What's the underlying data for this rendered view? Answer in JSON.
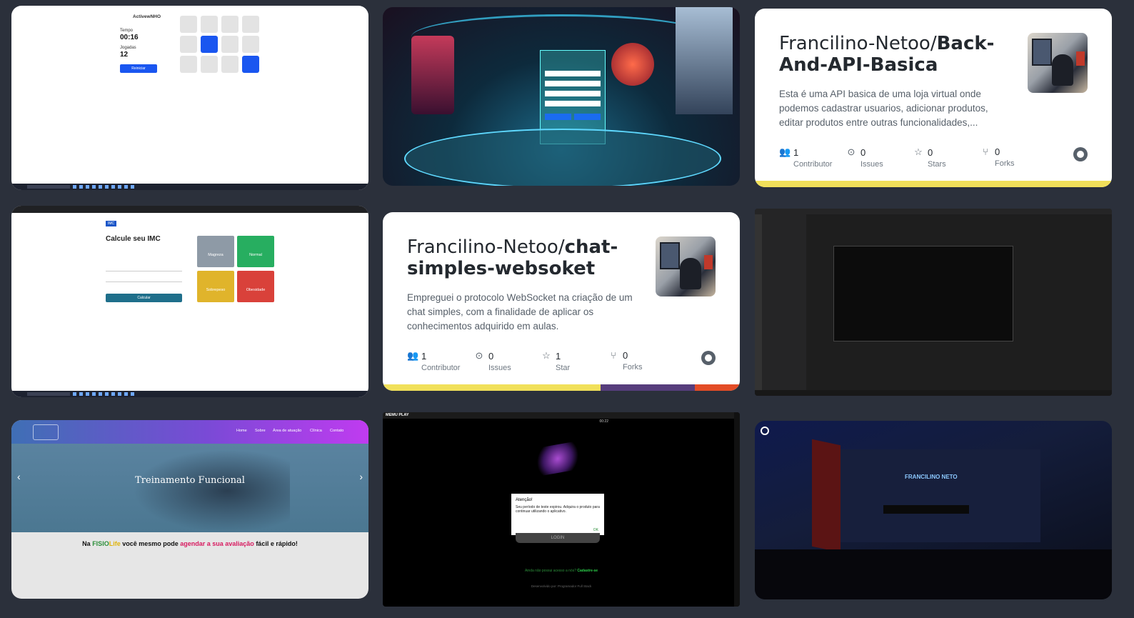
{
  "memory_game": {
    "title": "ActivewNHO",
    "time_label": "Tempo",
    "time_value": "00:16",
    "moves_label": "Jogadas",
    "moves_value": "12",
    "restart_label": "Reiniciar"
  },
  "repo1": {
    "owner": "Francilino-Netoo/",
    "name": "Back-And-API-Basica",
    "description": "Esta é uma API basica de uma loja virtual onde podemos cadastrar usuarios, adicionar produtos, editar produtos entre outras funcionalidades,...",
    "stats": [
      {
        "icon": "people-icon",
        "value": "1",
        "label": "Contributor"
      },
      {
        "icon": "issue-icon",
        "value": "0",
        "label": "Issues"
      },
      {
        "icon": "star-icon",
        "value": "0",
        "label": "Stars"
      },
      {
        "icon": "fork-icon",
        "value": "0",
        "label": "Forks"
      }
    ],
    "bar_colors": [
      "#f1e05a"
    ]
  },
  "imc": {
    "brand": "IMC",
    "title": "Calcule seu IMC",
    "button": "Calcular",
    "categories": [
      {
        "label": "Magreza",
        "color": "#8e9aa6"
      },
      {
        "label": "Normal",
        "color": "#27ae60"
      },
      {
        "label": "Sobrepeso",
        "color": "#e0b42b"
      },
      {
        "label": "Obesidade",
        "color": "#d9413a"
      }
    ]
  },
  "repo2": {
    "owner": "Francilino-Netoo/",
    "name": "chat-simples-websoket",
    "description": "Empreguei o protocolo WebSocket na criação de um chat simples, com a finalidade de aplicar os conhecimentos adquirido em aulas.",
    "stats": [
      {
        "icon": "people-icon",
        "value": "1",
        "label": "Contributor"
      },
      {
        "icon": "issue-icon",
        "value": "0",
        "label": "Issues"
      },
      {
        "icon": "star-icon",
        "value": "1",
        "label": "Star"
      },
      {
        "icon": "fork-icon",
        "value": "0",
        "label": "Forks"
      }
    ],
    "bar_colors": [
      "#f1e05a",
      "#563d7c",
      "#e34c26"
    ]
  },
  "physio": {
    "nav": [
      "Home",
      "Sobre",
      "Área de atuação",
      "Clínica",
      "Contato"
    ],
    "slide_title": "Treinamento Funcional",
    "tagline_pre": "Na ",
    "tagline_brand1": "FISIO",
    "tagline_brand2": "Life",
    "tagline_mid": " você mesmo pode ",
    "tagline_link": "agendar a sua avaliação",
    "tagline_post": " fácil e rápido!"
  },
  "emulator": {
    "app": "MEMU PLAY",
    "time": "00:22",
    "dialog_title": "Atenção!",
    "dialog_body": "Seu período de teste expirou. Adquira o produto para continuar utilizando o aplicativo.",
    "dialog_ok": "OK",
    "login": "LOGIN",
    "register_text": "Ainda não possui acesso a nós?",
    "register_link": "Cadastre-se",
    "footer": "Desenvolvido por: Programador Full Stack"
  },
  "room3d": {
    "sign": "FRANCILINO NETO"
  }
}
